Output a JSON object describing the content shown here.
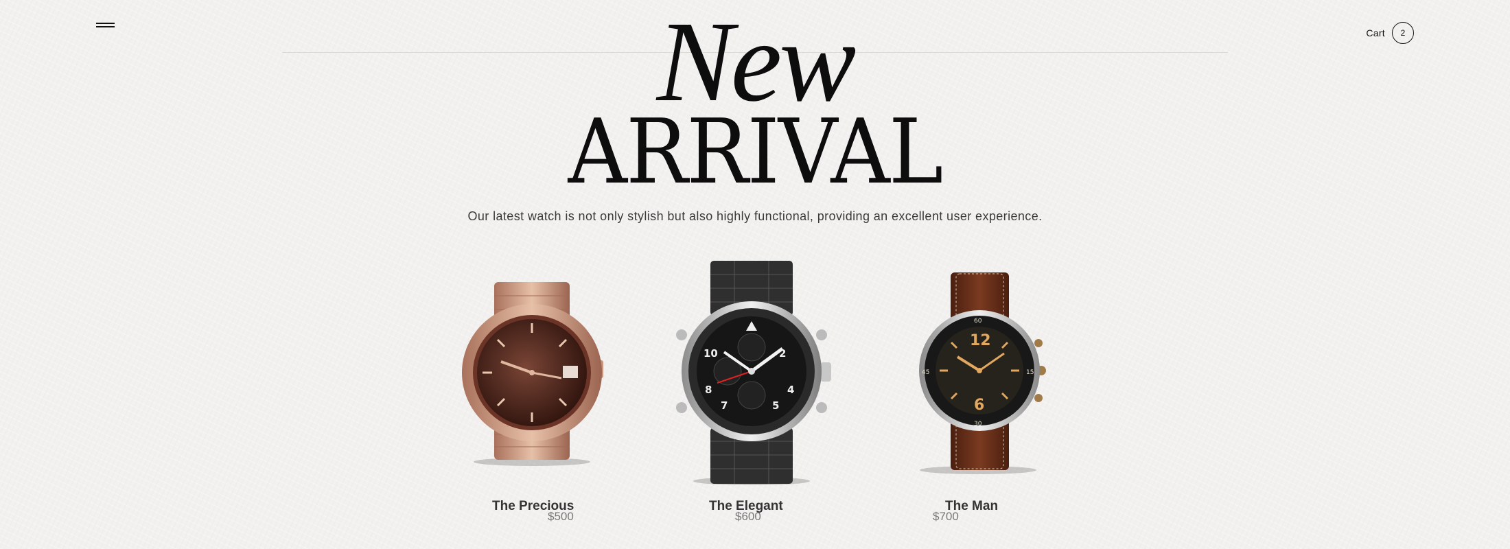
{
  "header": {
    "menu_icon": "hamburger-icon",
    "cart_label": "Cart",
    "cart_count": "2"
  },
  "hero": {
    "script_title": "New",
    "title": "ARRIVAL",
    "subtitle": "Our latest watch is not only stylish but also highly functional, providing an excellent user experience."
  },
  "products": [
    {
      "name": "The Precious",
      "price": "$500",
      "case_color": "#c8947a",
      "dial_color": "#4a2419",
      "strap": "rose-gold metal bracelet"
    },
    {
      "name": "The Elegant",
      "price": "$600",
      "case_color": "#b9b9b9",
      "dial_color": "#1a1a1a",
      "strap": "black metal bracelet"
    },
    {
      "name": "The Man",
      "price": "$700",
      "case_color": "#c9c9c9",
      "dial_color": "#1e1c18",
      "strap": "brown leather strap"
    }
  ]
}
